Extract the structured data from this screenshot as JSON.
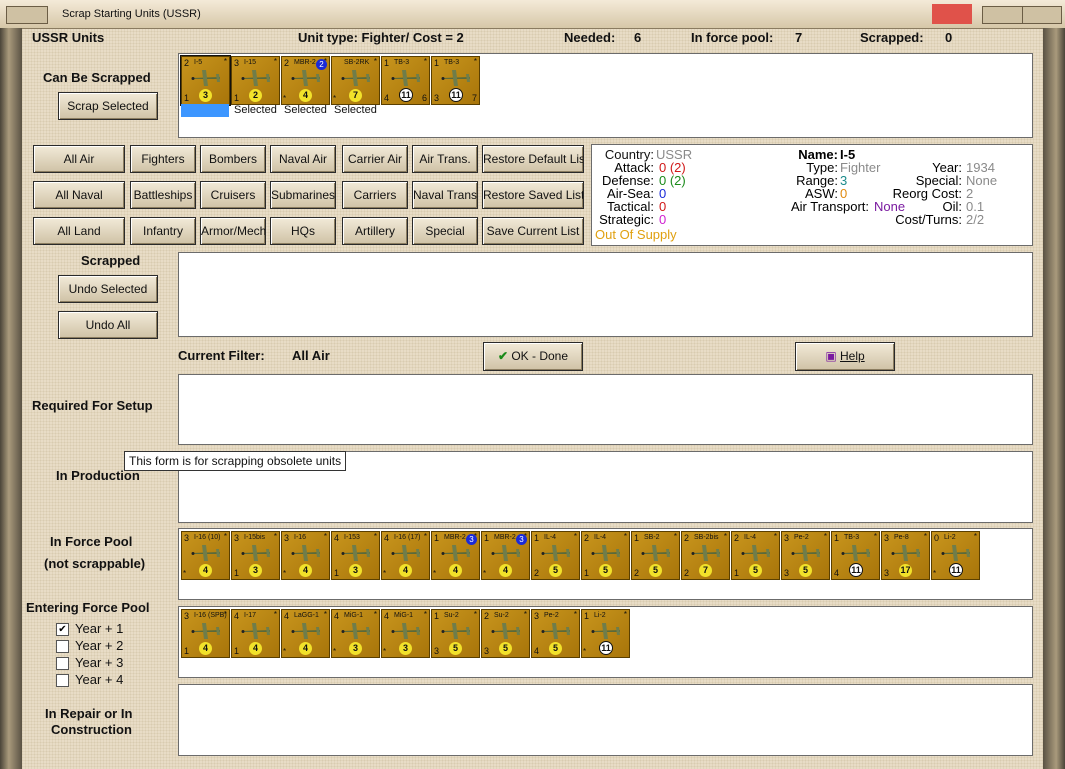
{
  "window": {
    "title": "Scrap Starting Units (USSR)"
  },
  "header": {
    "country_units": "USSR Units",
    "unit_type": "Unit type: Fighter/ Cost = 2",
    "needed_label": "Needed:",
    "needed": "6",
    "force_pool_label": "In force pool:",
    "force_pool": "7",
    "scrapped_label": "Scrapped:",
    "scrapped": "0"
  },
  "sections": {
    "can_be_scrapped": "Can Be Scrapped",
    "scrapped": "Scrapped",
    "current_filter_label": "Current Filter:",
    "current_filter": "All Air",
    "required_for_setup": "Required For Setup",
    "in_production": "In Production",
    "in_force_pool_1": "In Force Pool",
    "in_force_pool_2": "(not scrappable)",
    "entering_force_pool": "Entering Force Pool",
    "in_repair_1": "In Repair or In",
    "in_repair_2": "Construction"
  },
  "buttons": {
    "scrap_selected": "Scrap Selected",
    "undo_selected": "Undo Selected",
    "undo_all": "Undo All",
    "ok_done": "OK - Done",
    "help": "Help"
  },
  "filters": {
    "row1": [
      "All Air",
      "Fighters",
      "Bombers",
      "Naval Air",
      "Carrier Air",
      "Air Trans.",
      "Restore Default List"
    ],
    "row2": [
      "All Naval",
      "Battleships",
      "Cruisers",
      "Submarines",
      "Carriers",
      "Naval Trans.",
      "Restore Saved List"
    ],
    "row3": [
      "All Land",
      "Infantry",
      "Armor/Mech",
      "HQs",
      "Artillery",
      "Special",
      "Save Current List"
    ]
  },
  "unit_info": {
    "country_label": "Country:",
    "country": "USSR",
    "attack_label": "Attack:",
    "attack": "0 (2)",
    "defense_label": "Defense:",
    "defense": "0 (2)",
    "airsea_label": "Air-Sea:",
    "airsea": "0",
    "tactical_label": "Tactical:",
    "tactical": "0",
    "strategic_label": "Strategic:",
    "strategic": "0",
    "supply": "Out Of Supply",
    "name_label": "Name:",
    "name": "I-5",
    "type_label": "Type:",
    "type": "Fighter",
    "range_label": "Range:",
    "range": "3",
    "asw_label": "ASW:",
    "asw": "0",
    "air_transport_label": "Air Transport:",
    "air_transport": "None",
    "year_label": "Year:",
    "year": "1934",
    "special_label": "Special:",
    "special": "None",
    "reorg_label": "Reorg Cost:",
    "reorg": "2",
    "oil_label": "Oil:",
    "oil": "0.1",
    "cost_label": "Cost/Turns:",
    "cost": "2/2",
    "colors": {
      "attack": "#d01818",
      "defense": "#1a8a1a",
      "airsea": "#1a2ad8",
      "tactical": "#d01818",
      "strategic": "#d020d0",
      "supply": "#e0a010",
      "gray": "#8a8a8a",
      "range": "#1a8a8a",
      "asw": "#e08a10",
      "air_transport": "#7a1aa0"
    }
  },
  "can_scrap_units": [
    {
      "name": "I-5",
      "tl": "2",
      "bl": "1",
      "br": "",
      "circle": "3",
      "label": ""
    },
    {
      "name": "I-15",
      "tl": "3",
      "bl": "1",
      "br": "",
      "circle": "2",
      "label": "Selected"
    },
    {
      "name": "MBR-2",
      "tl": "2",
      "bl": "",
      "br": "",
      "circle": "4",
      "badge": "2",
      "label": "Selected"
    },
    {
      "name": "SB-2RK",
      "tl": "",
      "bl": "",
      "br": "",
      "circle": "7",
      "label": "Selected"
    },
    {
      "name": "TB-3",
      "tl": "1",
      "bl": "4",
      "br": "6",
      "circle": "11",
      "white": true,
      "label": ""
    },
    {
      "name": "TB-3",
      "tl": "1",
      "bl": "3",
      "br": "7",
      "circle": "11",
      "white": true,
      "label": ""
    }
  ],
  "force_pool_units": [
    {
      "name": "I-16 (10)",
      "tl": "3",
      "bl": "",
      "circle": "4"
    },
    {
      "name": "I-15bis",
      "tl": "3",
      "bl": "1",
      "circle": "3"
    },
    {
      "name": "I-16",
      "tl": "3",
      "bl": "",
      "circle": "4"
    },
    {
      "name": "I-153",
      "tl": "4",
      "bl": "1",
      "circle": "3"
    },
    {
      "name": "I-16 (17)",
      "tl": "4",
      "bl": "",
      "circle": "4"
    },
    {
      "name": "MBR-2",
      "tl": "1",
      "bl": "",
      "circle": "4",
      "badge": "3"
    },
    {
      "name": "MBR-2",
      "tl": "1",
      "bl": "",
      "circle": "4",
      "badge": "3"
    },
    {
      "name": "IL-4",
      "tl": "1",
      "bl": "2",
      "circle": "5"
    },
    {
      "name": "IL-4",
      "tl": "2",
      "bl": "1",
      "circle": "5"
    },
    {
      "name": "SB-2",
      "tl": "1",
      "bl": "2",
      "circle": "5"
    },
    {
      "name": "SB-2bis",
      "tl": "2",
      "bl": "2",
      "circle": "7"
    },
    {
      "name": "IL-4",
      "tl": "2",
      "bl": "1",
      "circle": "5"
    },
    {
      "name": "Pe-2",
      "tl": "3",
      "bl": "3",
      "circle": "5"
    },
    {
      "name": "TB-3",
      "tl": "1",
      "bl": "4",
      "circle": "11",
      "white": true
    },
    {
      "name": "Pe-8",
      "tl": "3",
      "bl": "3",
      "circle": "17"
    },
    {
      "name": "Li-2",
      "tl": "0",
      "bl": "",
      "circle": "11",
      "white": true
    }
  ],
  "entering_units": [
    {
      "name": "I-16 (SPB)",
      "tl": "3",
      "bl": "1",
      "circle": "4"
    },
    {
      "name": "I-17",
      "tl": "4",
      "bl": "1",
      "circle": "4"
    },
    {
      "name": "LaGG-1",
      "tl": "4",
      "bl": "",
      "circle": "4"
    },
    {
      "name": "MiG-1",
      "tl": "4",
      "bl": "",
      "circle": "3"
    },
    {
      "name": "MiG-1",
      "tl": "4",
      "bl": "",
      "circle": "3"
    },
    {
      "name": "Su-2",
      "tl": "1",
      "bl": "3",
      "circle": "5"
    },
    {
      "name": "Su-2",
      "tl": "2",
      "bl": "3",
      "circle": "5"
    },
    {
      "name": "Pe-2",
      "tl": "3",
      "bl": "4",
      "circle": "5"
    },
    {
      "name": "Li-2",
      "tl": "1",
      "bl": "",
      "circle": "11",
      "white": true
    }
  ],
  "year_options": [
    {
      "label": "Year + 1",
      "checked": true
    },
    {
      "label": "Year + 2",
      "checked": false
    },
    {
      "label": "Year + 3",
      "checked": false
    },
    {
      "label": "Year + 4",
      "checked": false
    }
  ],
  "tooltip": "This form is for scrapping obsolete units"
}
